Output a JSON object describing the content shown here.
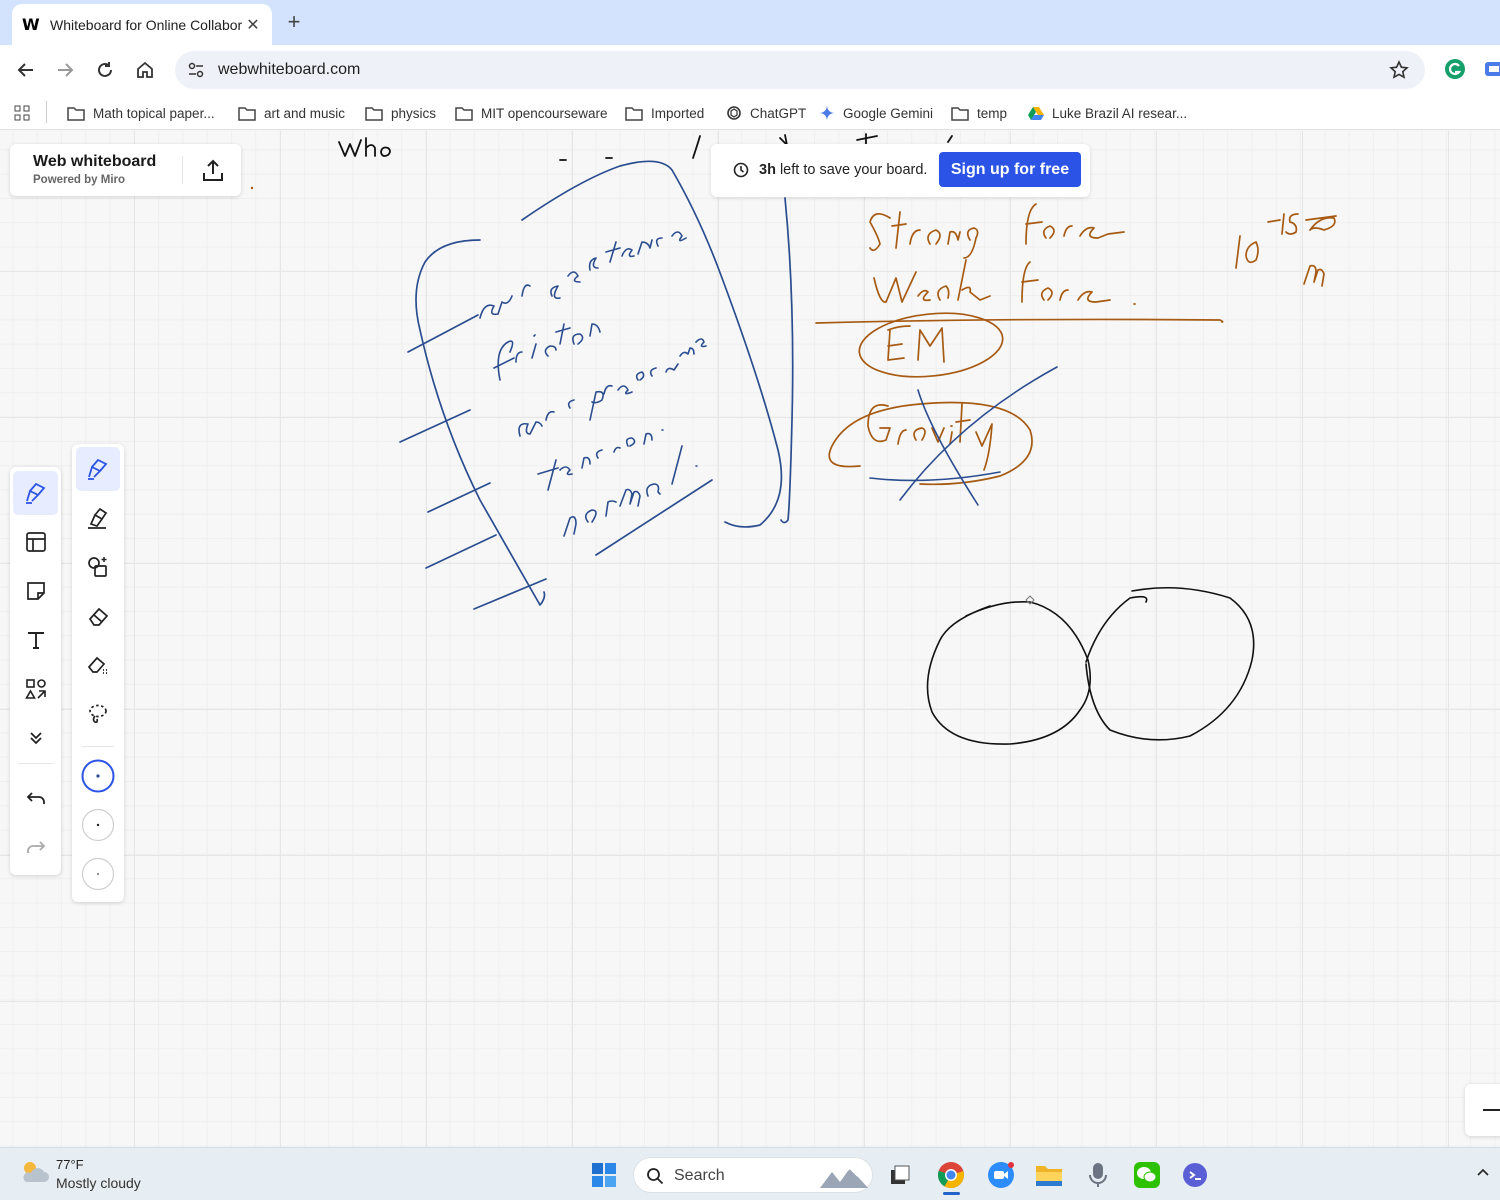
{
  "browser": {
    "tab": {
      "favicon": "W",
      "title": "Whiteboard for Online Collabor",
      "close": "✕"
    },
    "new_tab": "+",
    "url": "webwhiteboard.com",
    "bookmarks": [
      {
        "label": "Math topical paper...",
        "icon": "folder-icon"
      },
      {
        "label": "art and music",
        "icon": "folder-icon"
      },
      {
        "label": "physics",
        "icon": "folder-icon"
      },
      {
        "label": "MIT opencourseware",
        "icon": "folder-icon"
      },
      {
        "label": "Imported",
        "icon": "folder-icon"
      },
      {
        "label": "ChatGPT",
        "icon": "chatgpt-icon"
      },
      {
        "label": "Google Gemini",
        "icon": "gemini-icon"
      },
      {
        "label": "temp",
        "icon": "folder-icon"
      },
      {
        "label": "Luke Brazil AI resear...",
        "icon": "drive-icon"
      }
    ]
  },
  "whiteboard": {
    "brand_title": "Web whiteboard",
    "brand_sub": "Powered by Miro",
    "save_banner": {
      "bold": "3h",
      "text": " left to save your board.",
      "button": "Sign up for free"
    },
    "accent": "#2b54e6",
    "ink_colors": {
      "blue": "#2a4d8f",
      "brown": "#a65a12",
      "black": "#111111"
    }
  },
  "taskbar": {
    "weather_temp": "77°F",
    "weather_desc": "Mostly cloudy",
    "search": "Search"
  }
}
